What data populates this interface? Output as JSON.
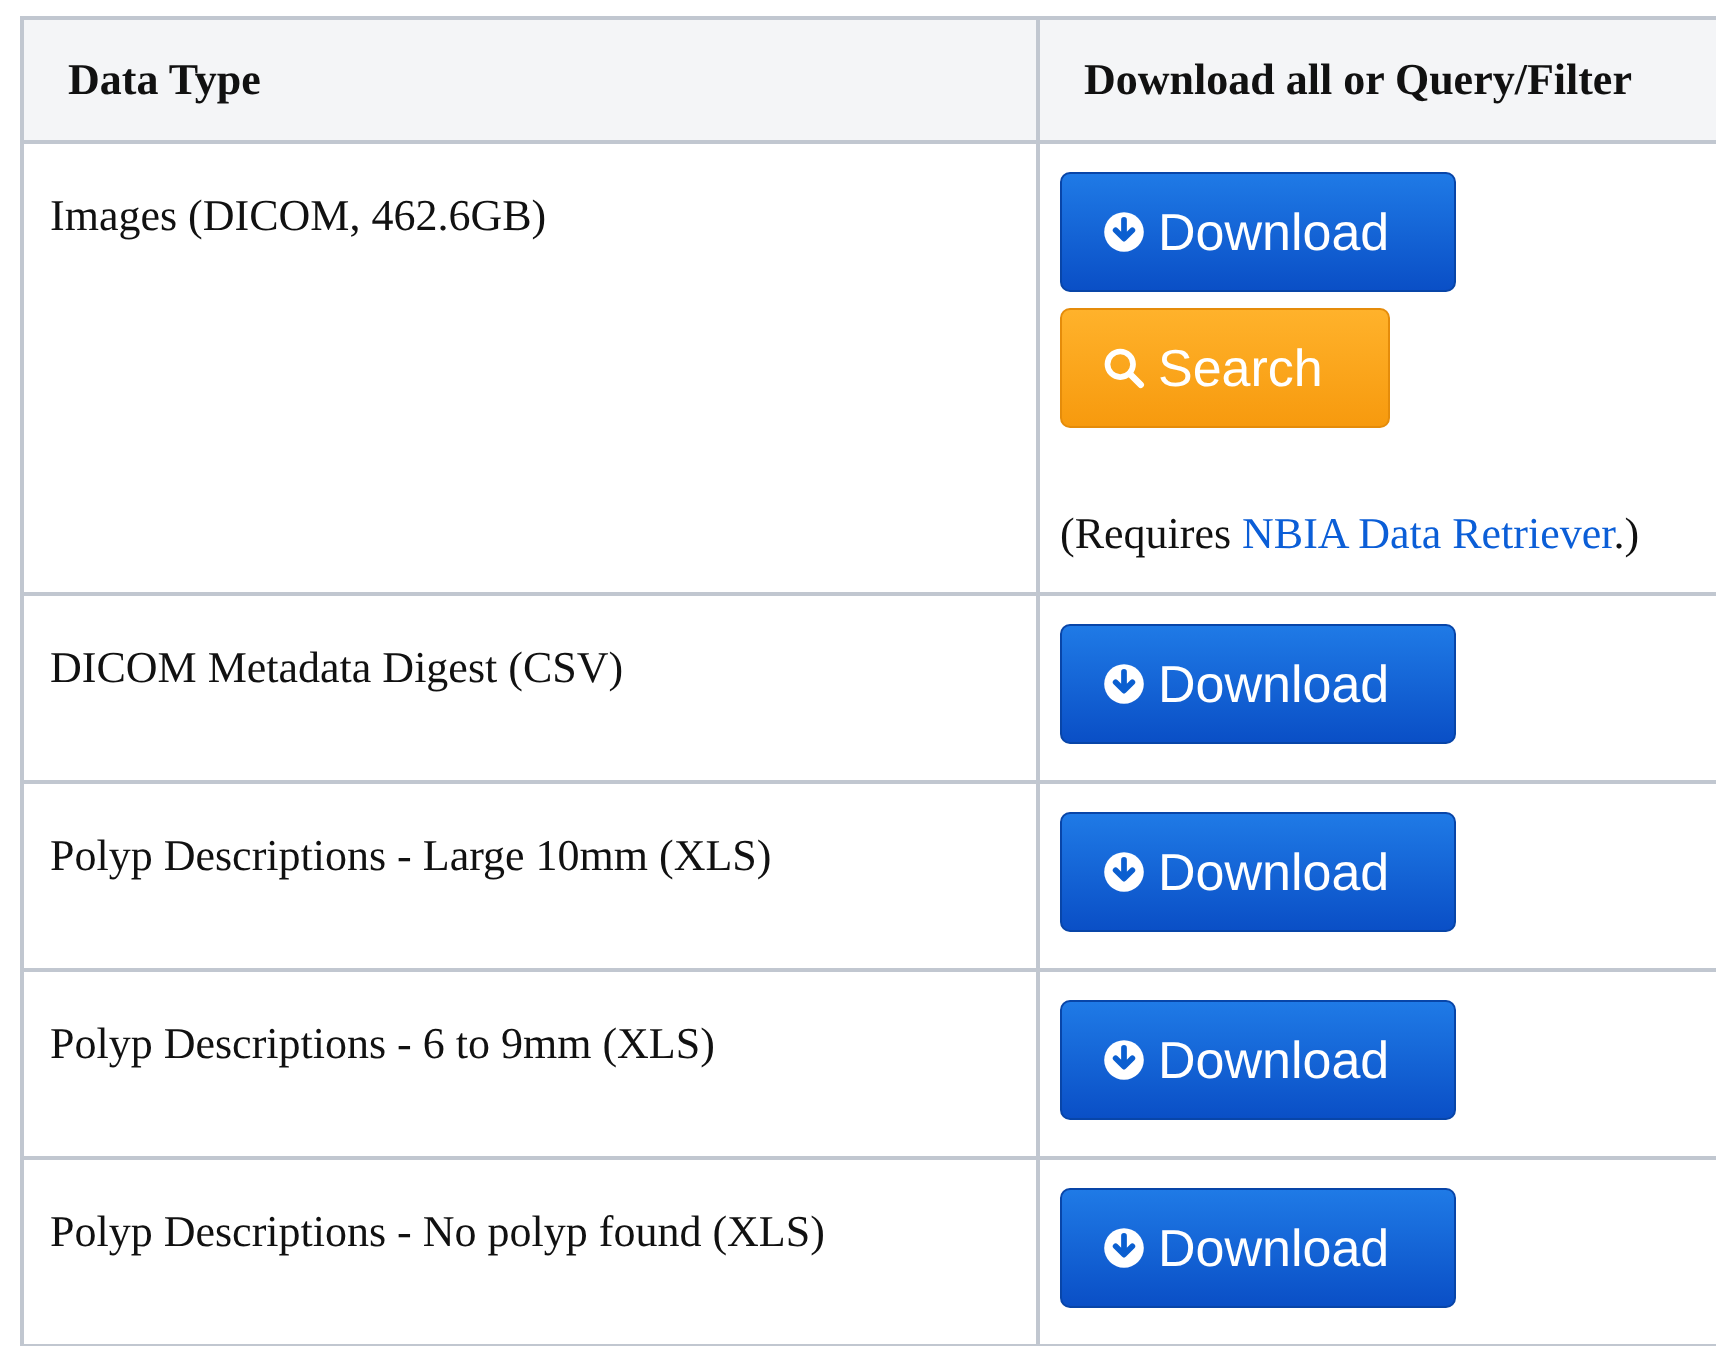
{
  "table": {
    "columns": [
      "Data Type",
      "Download all or Query/Filter"
    ],
    "rows": [
      {
        "data_type": "Images (DICOM, 462.6GB)",
        "actions": [
          {
            "kind": "download",
            "label": "Download"
          },
          {
            "kind": "search",
            "label": "Search"
          }
        ],
        "note": {
          "before": "(Requires ",
          "link": "NBIA Data Retriever",
          "after": ".)"
        }
      },
      {
        "data_type": "DICOM Metadata Digest (CSV)",
        "actions": [
          {
            "kind": "download",
            "label": "Download"
          }
        ]
      },
      {
        "data_type": "Polyp Descriptions - Large 10mm (XLS)",
        "actions": [
          {
            "kind": "download",
            "label": "Download"
          }
        ]
      },
      {
        "data_type": "Polyp Descriptions - 6 to 9mm (XLS)",
        "actions": [
          {
            "kind": "download",
            "label": "Download"
          }
        ]
      },
      {
        "data_type": "Polyp Descriptions - No polyp found (XLS)",
        "actions": [
          {
            "kind": "download",
            "label": "Download"
          }
        ]
      }
    ]
  }
}
